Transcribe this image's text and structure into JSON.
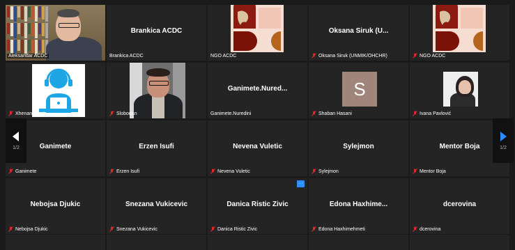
{
  "tiles": [
    {
      "kind": "video",
      "variant": "bookshelf",
      "label": "Aleksandar ACDC",
      "active": true
    },
    {
      "kind": "name",
      "center": "Brankica ACDC",
      "label": "Brankica ACDC"
    },
    {
      "kind": "logo",
      "label": "NGO ACDC",
      "muted": false
    },
    {
      "kind": "name",
      "center": "Oksana Siruk (U...",
      "label": "Oksana Siruk (UNMIK/OHCHR)",
      "muted": true
    },
    {
      "kind": "logo",
      "label": "NGO ACDC",
      "muted": true
    },
    {
      "kind": "headset",
      "label": "Xhenana Arzt",
      "muted": true
    },
    {
      "kind": "video",
      "variant": "slobodan",
      "label": "Slobodan",
      "muted": true
    },
    {
      "kind": "name",
      "center": "Ganimete.Nured...",
      "label": "Ganimete.Nuredini"
    },
    {
      "kind": "avatar",
      "initial": "S",
      "label": "Shaban Hasani",
      "muted": true
    },
    {
      "kind": "photo",
      "label": "Ivana Pavlović",
      "muted": true
    },
    {
      "kind": "name",
      "center": "Ganimete",
      "label": "Ganimete",
      "muted": true
    },
    {
      "kind": "name",
      "center": "Erzen Isufi",
      "label": "Erzen Isufi",
      "muted": true
    },
    {
      "kind": "name",
      "center": "Nevena Vuletic",
      "label": "Nevena Vuletic",
      "muted": true
    },
    {
      "kind": "name",
      "center": "Sylejmon",
      "label": "Sylejmon",
      "muted": true
    },
    {
      "kind": "name",
      "center": "Mentor Boja",
      "label": "Mentor Boja",
      "muted": true
    },
    {
      "kind": "name",
      "center": "Nebojsa Djukic",
      "label": "Nebojsa Djukic",
      "muted": true
    },
    {
      "kind": "name",
      "center": "Snezana Vukicevic",
      "label": "Snezana Vukicevic",
      "muted": true
    },
    {
      "kind": "name",
      "center": "Danica Ristic Zivic",
      "label": "Danica Ristic Zivic",
      "muted": true,
      "more": true
    },
    {
      "kind": "name",
      "center": "Edona Haxhime...",
      "label": "Edona Haxhimehmeti",
      "muted": true
    },
    {
      "kind": "name",
      "center": "dcerovina",
      "label": "dcerovina",
      "muted": true
    }
  ],
  "nav": {
    "left_page": "1/2",
    "right_page": "1/2"
  },
  "icons": {
    "muted": "mic-muted-icon",
    "prev": "arrow-left-icon",
    "next": "arrow-right-icon",
    "more": "more-options-icon"
  },
  "colors": {
    "tile_bg": "#242424",
    "muted_red": "#e02828",
    "accent_blue": "#2d8cff",
    "active_outline": "#d6e3a0"
  }
}
